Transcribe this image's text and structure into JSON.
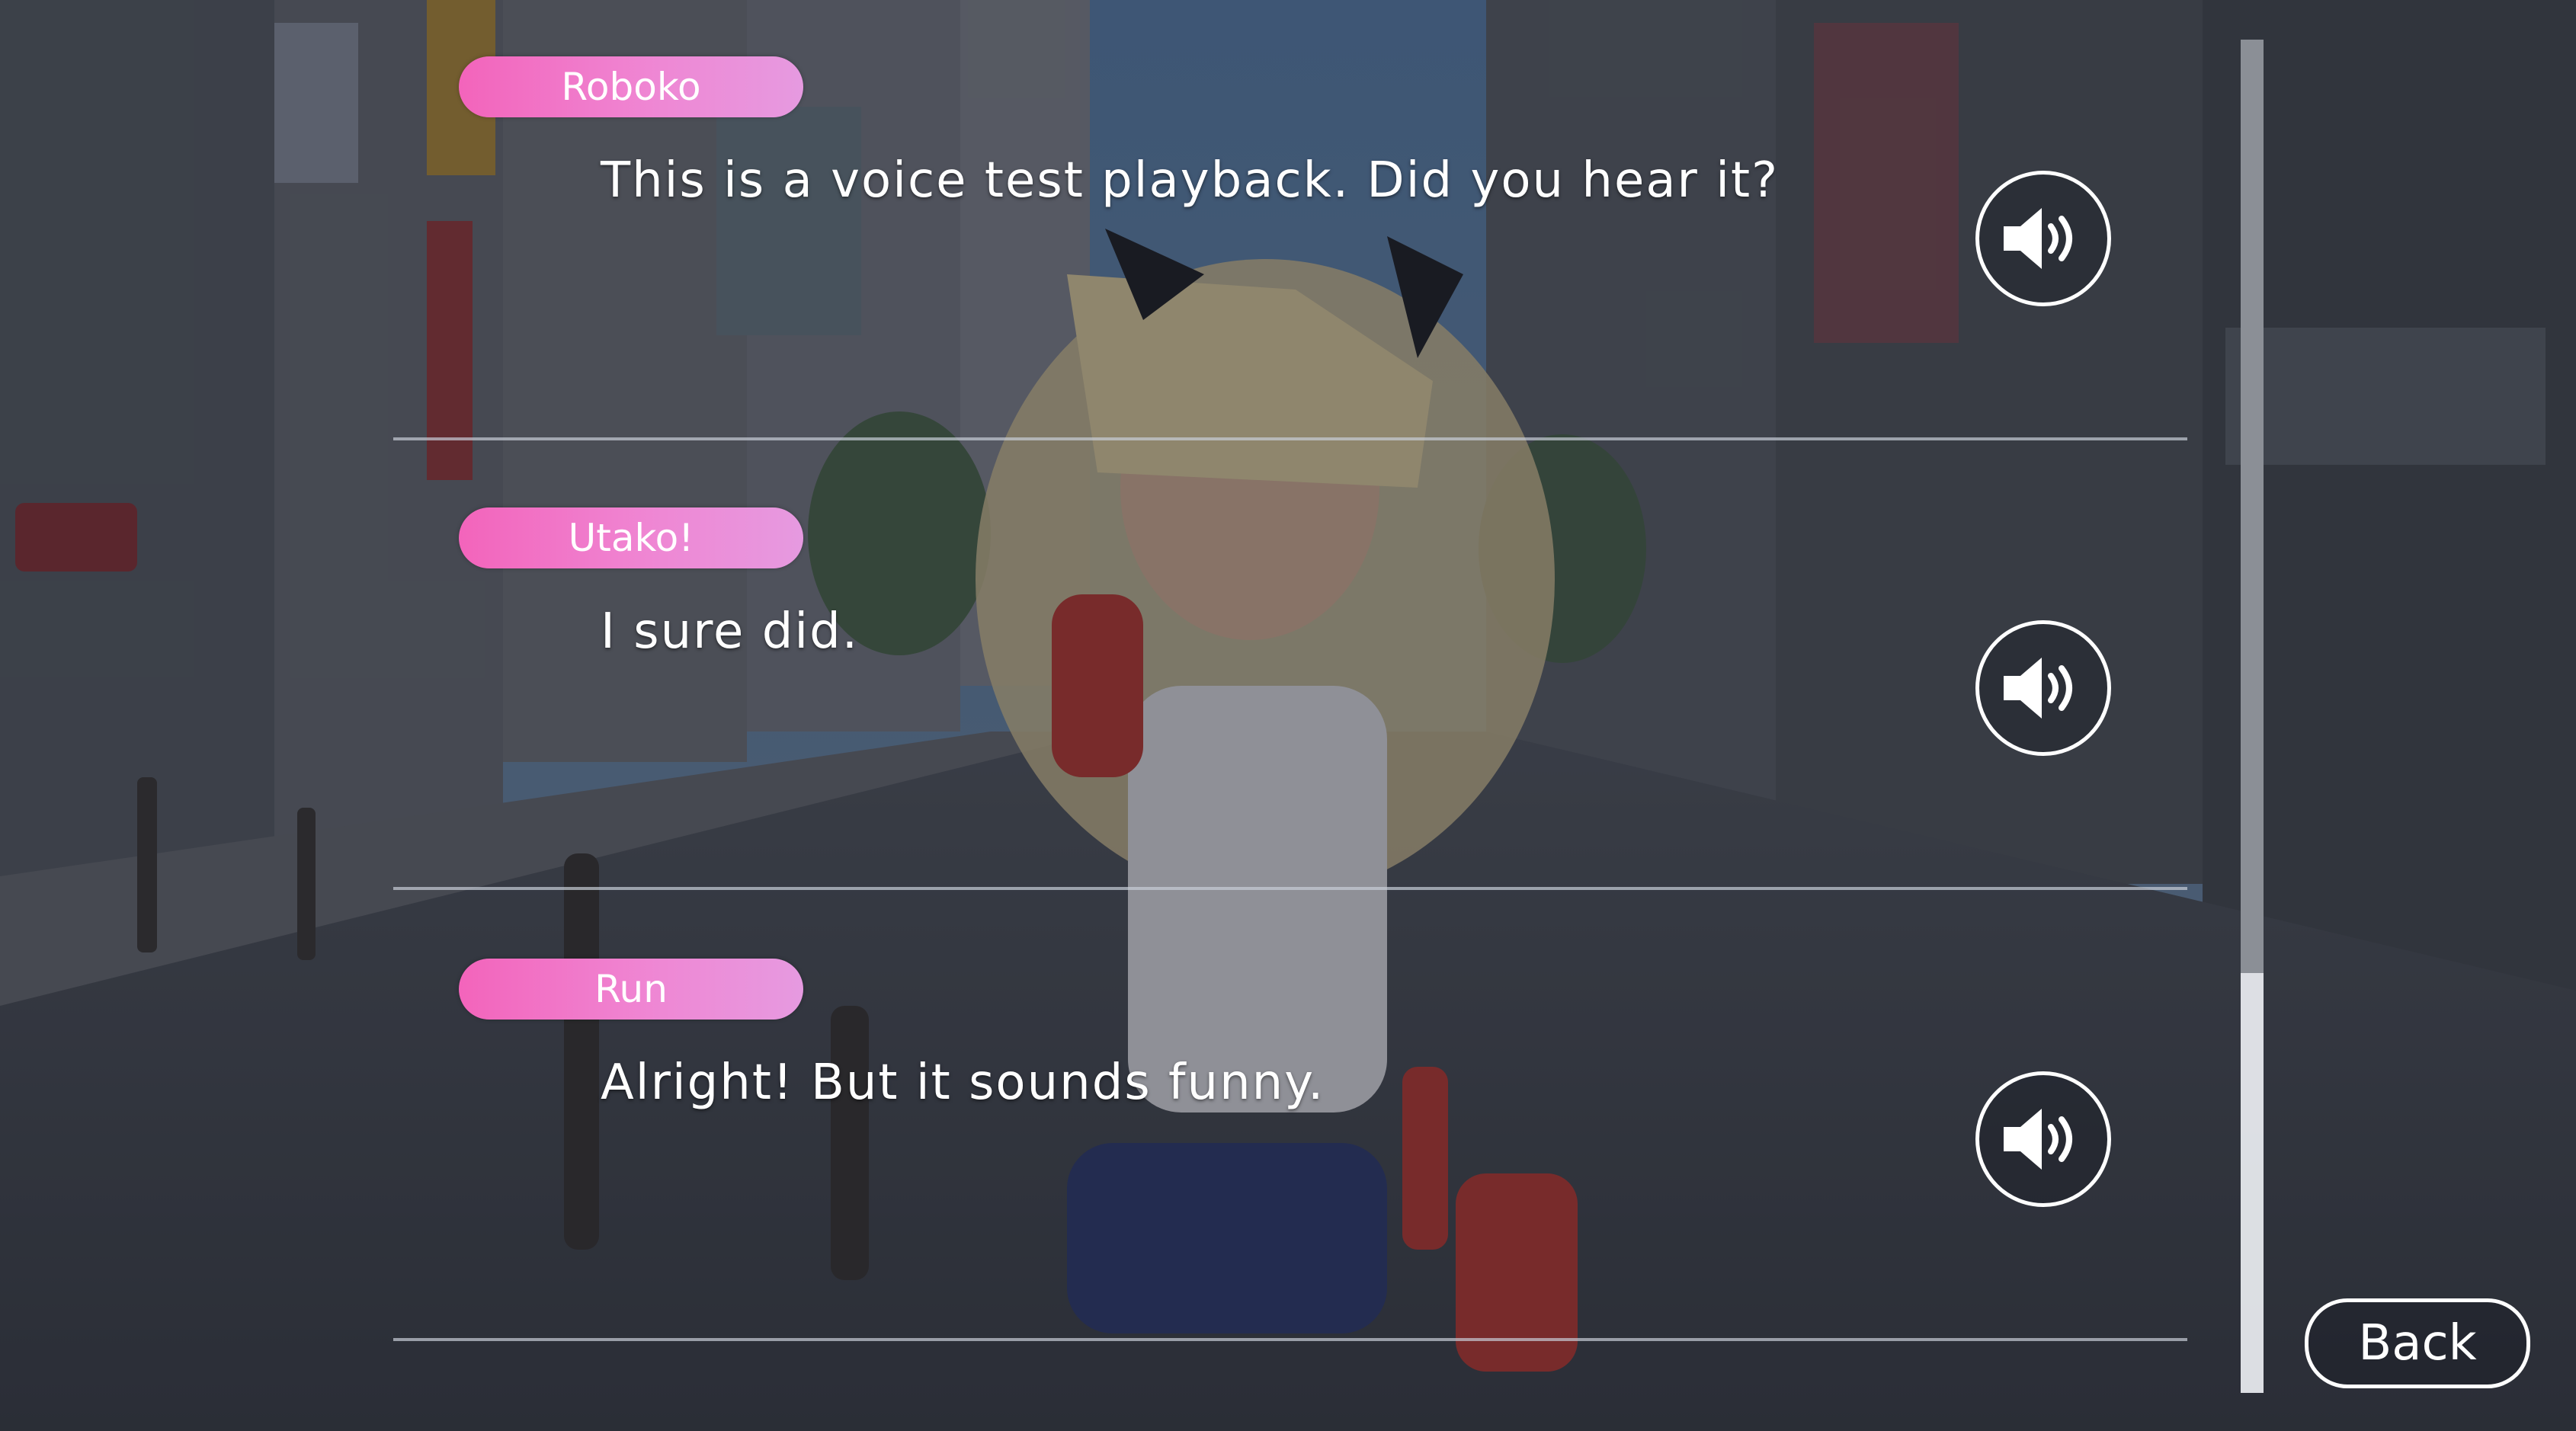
{
  "backlog": {
    "entries": [
      {
        "speaker": "Roboko",
        "text": "This is a voice test playback. Did you hear it?",
        "voice_icon": "speaker-volume-icon"
      },
      {
        "speaker": "Utako!",
        "text": "I sure did.",
        "voice_icon": "speaker-volume-icon"
      },
      {
        "speaker": "Run",
        "text": "Alright! But it sounds funny.",
        "voice_icon": "speaker-volume-icon"
      }
    ],
    "scrollbar": {
      "position_fraction": 0.0,
      "visible_fraction": 0.69
    },
    "back_label": "Back"
  },
  "colors": {
    "name_tag_start": "#f364bb",
    "name_tag_end": "#e69ae0",
    "text": "#ffffff",
    "overlay": "#12161e"
  }
}
